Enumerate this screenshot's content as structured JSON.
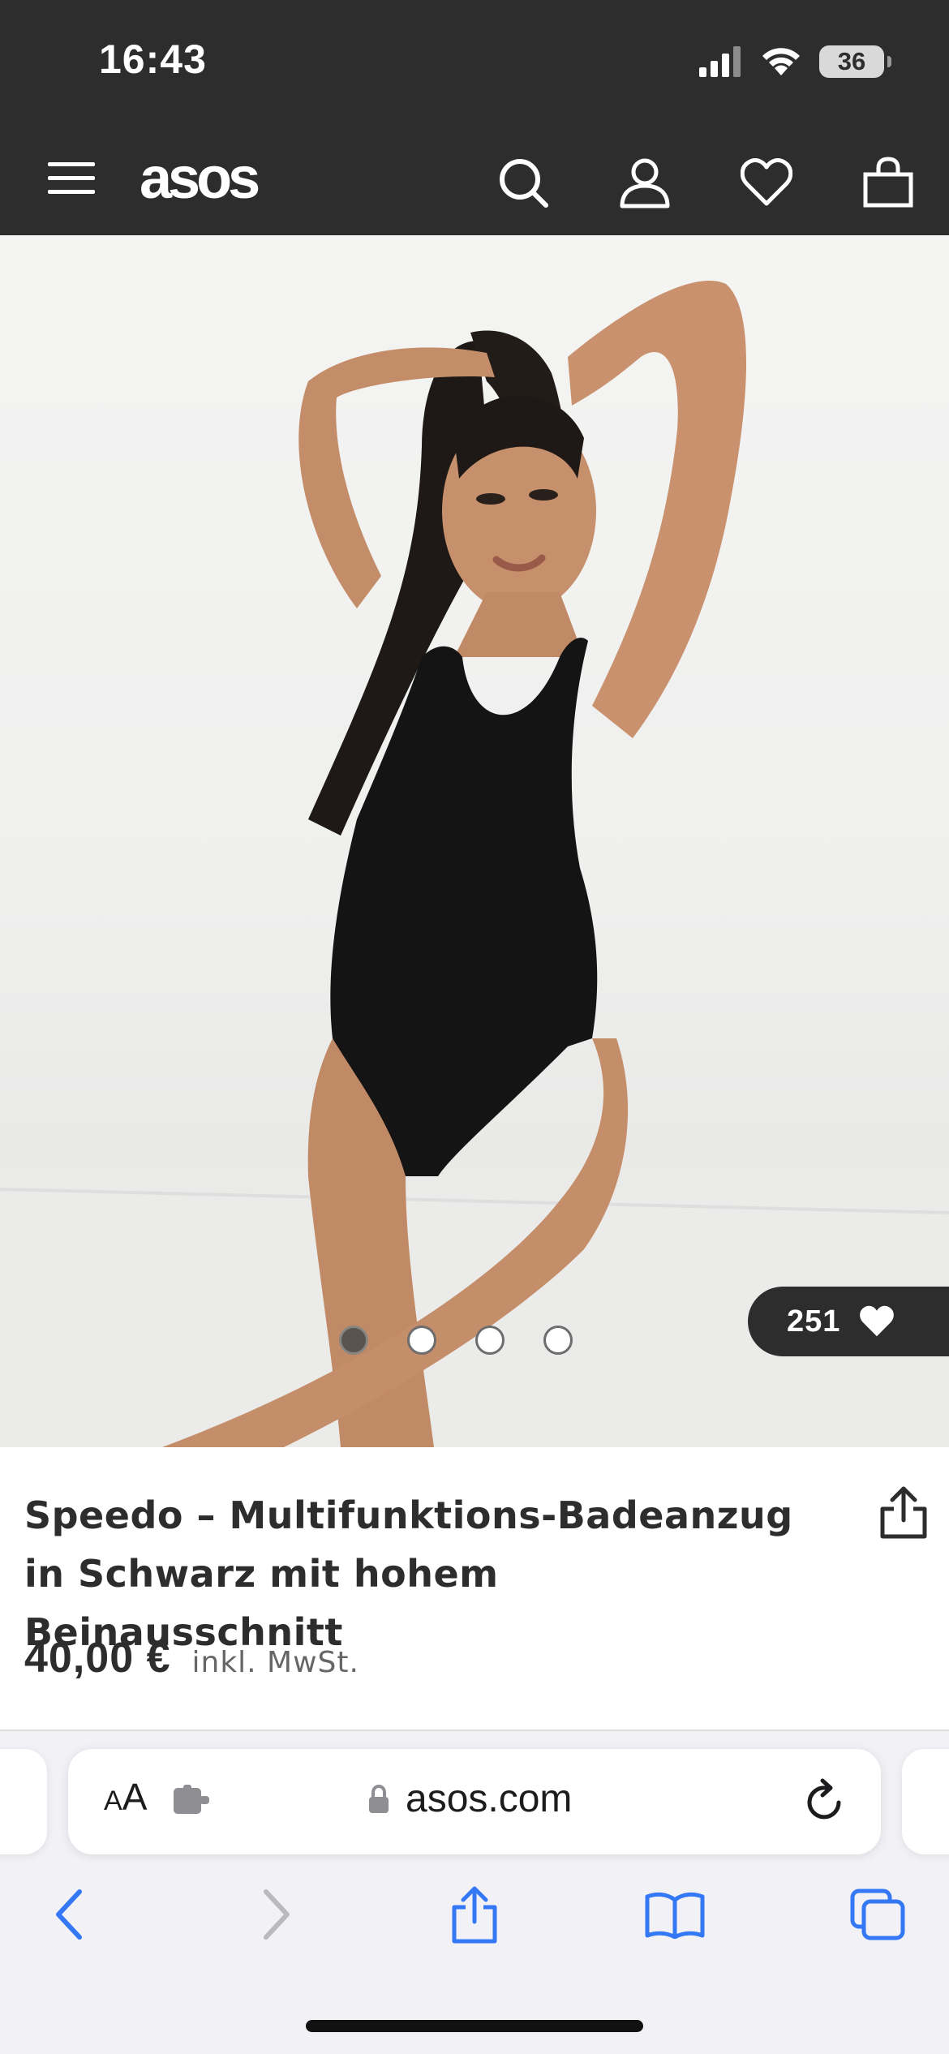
{
  "status_bar": {
    "time": "16:43",
    "battery": "36",
    "icons": [
      "signal-icon",
      "wifi-icon",
      "battery-icon"
    ]
  },
  "header": {
    "logo": "asos",
    "icons": [
      "menu-icon",
      "search-icon",
      "account-icon",
      "heart-icon",
      "bag-icon"
    ]
  },
  "gallery": {
    "image_count": 4,
    "active_index": 0,
    "saved_count": "251"
  },
  "product": {
    "title": "Speedo – Multifunktions-Badeanzug in Schwarz mit hohem Beinausschnitt",
    "price": "40,00 €",
    "vat_note": "inkl. MwSt."
  },
  "browser": {
    "reader_label_small": "A",
    "reader_label_big": "A",
    "url": "asos.com",
    "toolbar_icons": [
      "back-icon",
      "forward-icon",
      "share-icon",
      "bookmarks-icon",
      "tabs-icon"
    ]
  },
  "colors": {
    "header_bg": "#2d2d2d",
    "text": "#2d2d2d",
    "safari_blue": "#3478f6",
    "safari_bg": "#f2f2f6"
  }
}
